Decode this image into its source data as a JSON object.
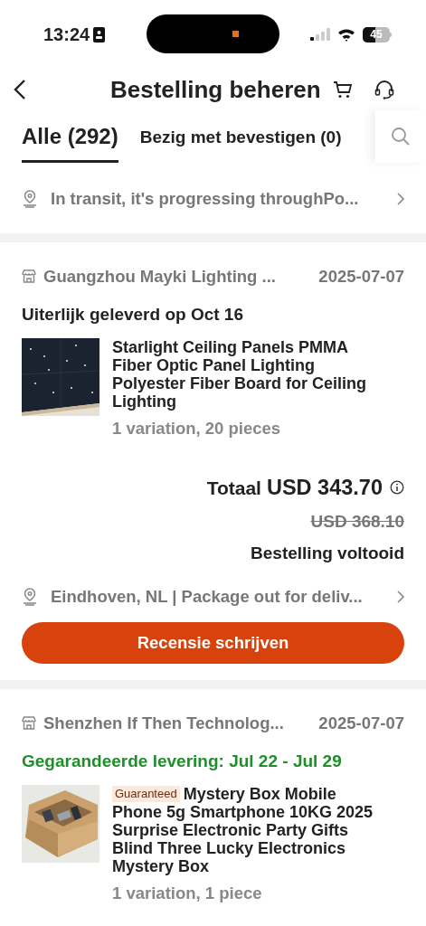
{
  "status_bar": {
    "time": "13:24",
    "battery": "45"
  },
  "header": {
    "title": "Bestelling beheren"
  },
  "tabs": [
    {
      "label": "Alle (292)",
      "selected": true
    },
    {
      "label": "Bezig met bevestigen (0)",
      "selected": false
    }
  ],
  "orders": [
    {
      "tracking": "In transit, it's progressing throughPo..."
    },
    {
      "store": "Guangzhou Mayki Lighting ...",
      "date": "2025-07-07",
      "delivery": {
        "kind": "deadline",
        "text": "Uiterlijk geleverd op Oct 16"
      },
      "product": {
        "title": "Starlight Ceiling Panels PMMA Fiber Optic Panel Lighting Polyester Fiber Board for Ceiling Lighting",
        "variation": "1 variation, 20 pieces"
      },
      "total_label": "Totaal",
      "total": "USD 343.70",
      "original_price": "USD 368.10",
      "status": "Bestelling voltooid",
      "tracking": "Eindhoven, NL | Package out for deliv...",
      "button": "Recensie schrijven"
    },
    {
      "store": "Shenzhen If Then Technolog...",
      "date": "2025-07-07",
      "delivery": {
        "kind": "guaranteed",
        "text": "Gegarandeerde levering: Jul 22 - Jul 29"
      },
      "product": {
        "badge": "Guaranteed",
        "title": "Mystery Box Mobile Phone 5g Smartphone 10KG 2025 Surprise Electronic Party Gifts Blind Three Lucky Electronics Mystery Box",
        "variation": "1 variation, 1 piece"
      }
    }
  ]
}
